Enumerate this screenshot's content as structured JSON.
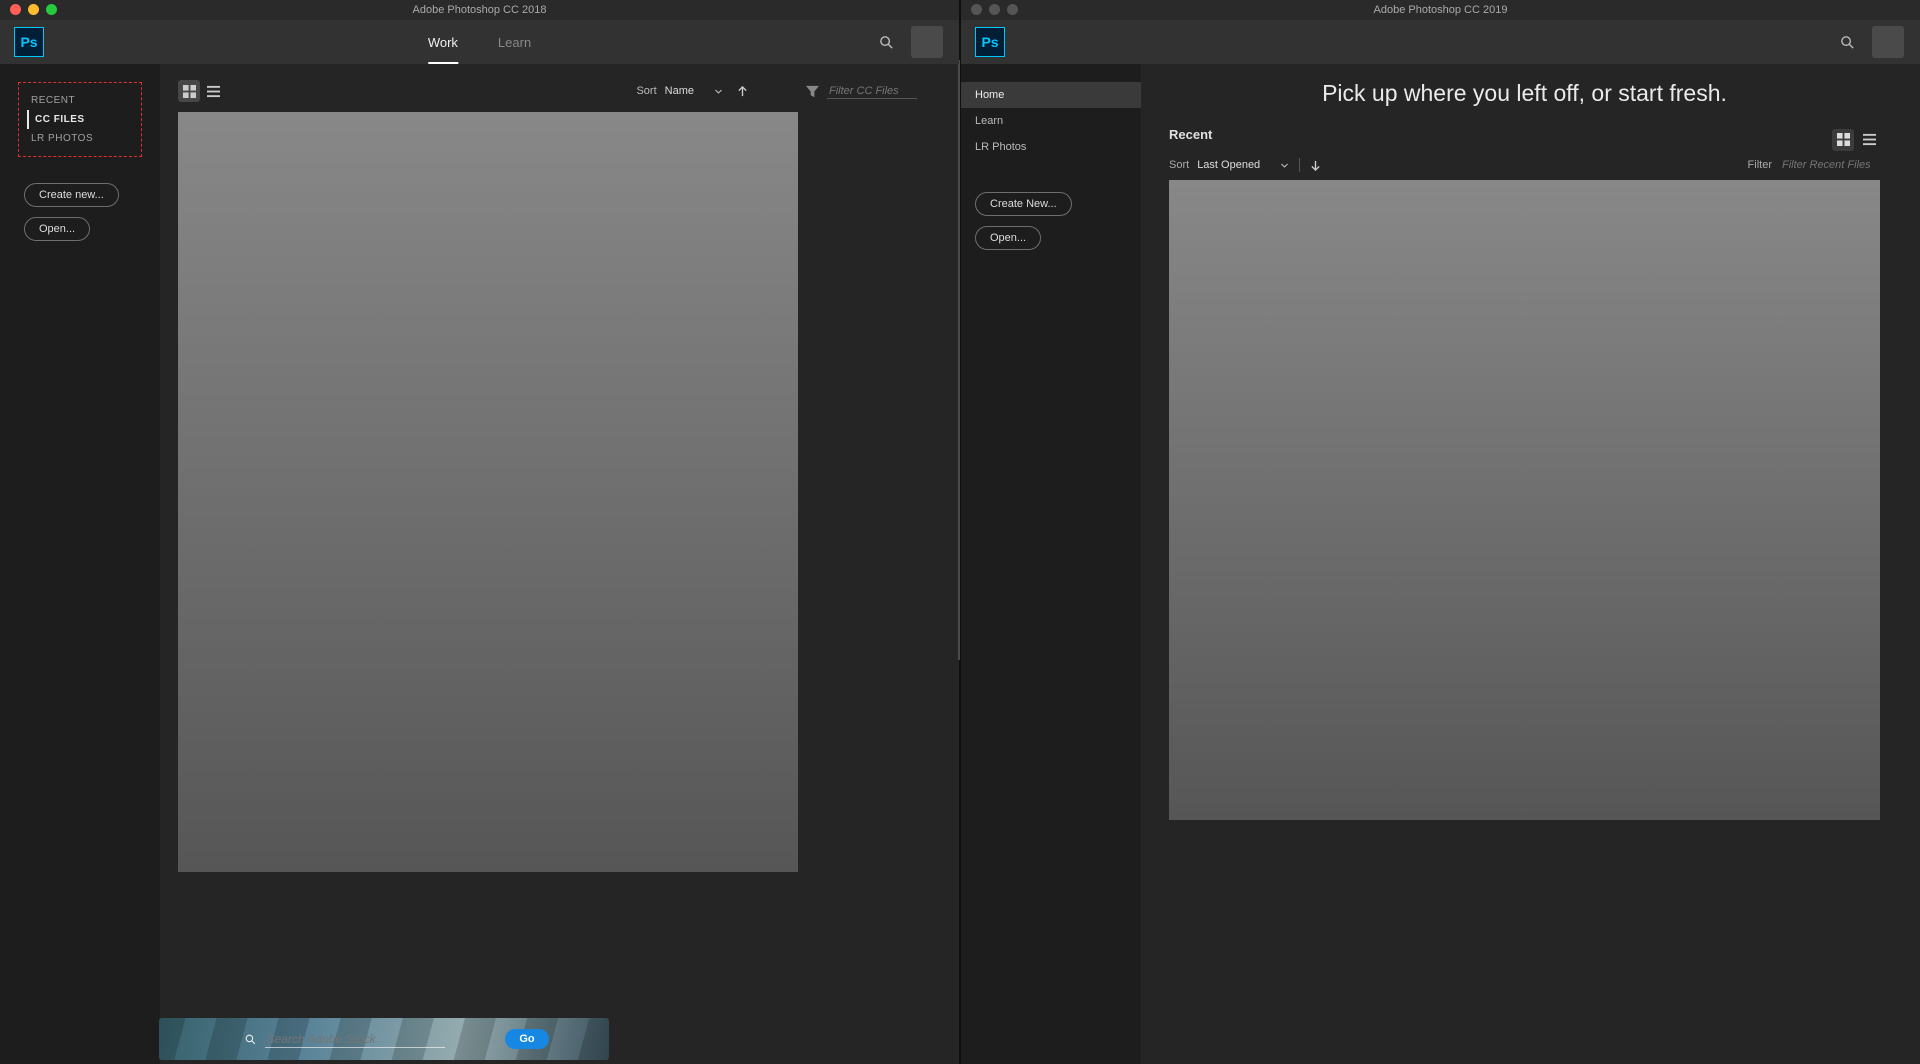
{
  "left": {
    "title": "Adobe Photoshop CC 2018",
    "tabs": {
      "work": "Work",
      "learn": "Learn"
    },
    "sidebar": {
      "nav": {
        "recent": "RECENT",
        "cc": "CC FILES",
        "lr": "LR PHOTOS"
      },
      "create": "Create new...",
      "open": "Open..."
    },
    "toolbar": {
      "sort_label": "Sort",
      "sort_value": "Name",
      "filter_placeholder": "Filter CC Files"
    },
    "stock": {
      "placeholder": "Search Adobe Stock",
      "go": "Go"
    }
  },
  "right": {
    "title": "Adobe Photoshop CC 2019",
    "headline": "Pick up where you left off, or start fresh.",
    "section": "Recent",
    "sidebar": {
      "home": "Home",
      "learn": "Learn",
      "lr": "LR Photos",
      "create": "Create New...",
      "open": "Open..."
    },
    "toolbar": {
      "sort_label": "Sort",
      "sort_value": "Last Opened",
      "filter_label": "Filter",
      "filter_placeholder": "Filter Recent Files"
    }
  }
}
